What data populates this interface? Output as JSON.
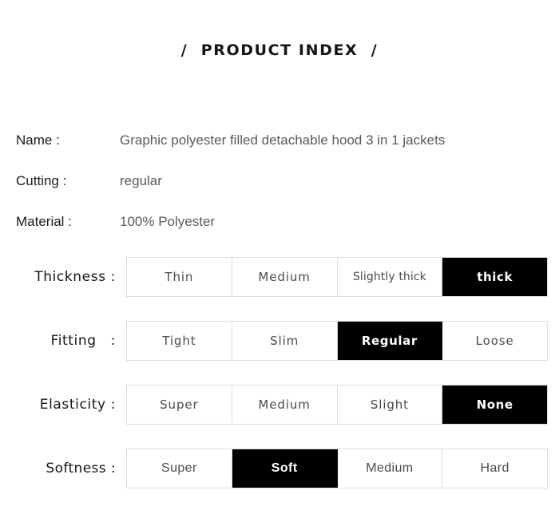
{
  "header": {
    "title": "/  PRODUCT INDEX  /"
  },
  "info_rows": [
    {
      "label": "Name :",
      "value": "Graphic polyester filled detachable hood 3 in 1 jackets"
    },
    {
      "label": "Cutting :",
      "value": "regular"
    },
    {
      "label": "Material :",
      "value": "100% Polyester"
    }
  ],
  "attribute_rows": [
    {
      "label": "Thickness :",
      "options": [
        {
          "text": "Thin",
          "selected": false
        },
        {
          "text": "Medium",
          "selected": false
        },
        {
          "text": "Slightly thick",
          "selected": false
        },
        {
          "text": "thick",
          "selected": true
        }
      ]
    },
    {
      "label": "Fitting   :",
      "options": [
        {
          "text": "Tight",
          "selected": false
        },
        {
          "text": "Slim",
          "selected": false
        },
        {
          "text": "Regular",
          "selected": true
        },
        {
          "text": "Loose",
          "selected": false
        }
      ]
    },
    {
      "label": "Elasticity :",
      "options": [
        {
          "text": "Super",
          "selected": false
        },
        {
          "text": "Medium",
          "selected": false
        },
        {
          "text": "Slight",
          "selected": false
        },
        {
          "text": "None",
          "selected": true
        }
      ]
    },
    {
      "label": "Softness :",
      "options": [
        {
          "text": "Super",
          "selected": false
        },
        {
          "text": "Soft",
          "selected": true
        },
        {
          "text": "Medium",
          "selected": false
        },
        {
          "text": "Hard",
          "selected": false
        }
      ]
    }
  ],
  "colors": {
    "selected_background": "#000000",
    "selected_text": "#ffffff",
    "cell_border": "#dcdcdc",
    "label_text": "#141414",
    "value_text": "#5a5a5a"
  }
}
